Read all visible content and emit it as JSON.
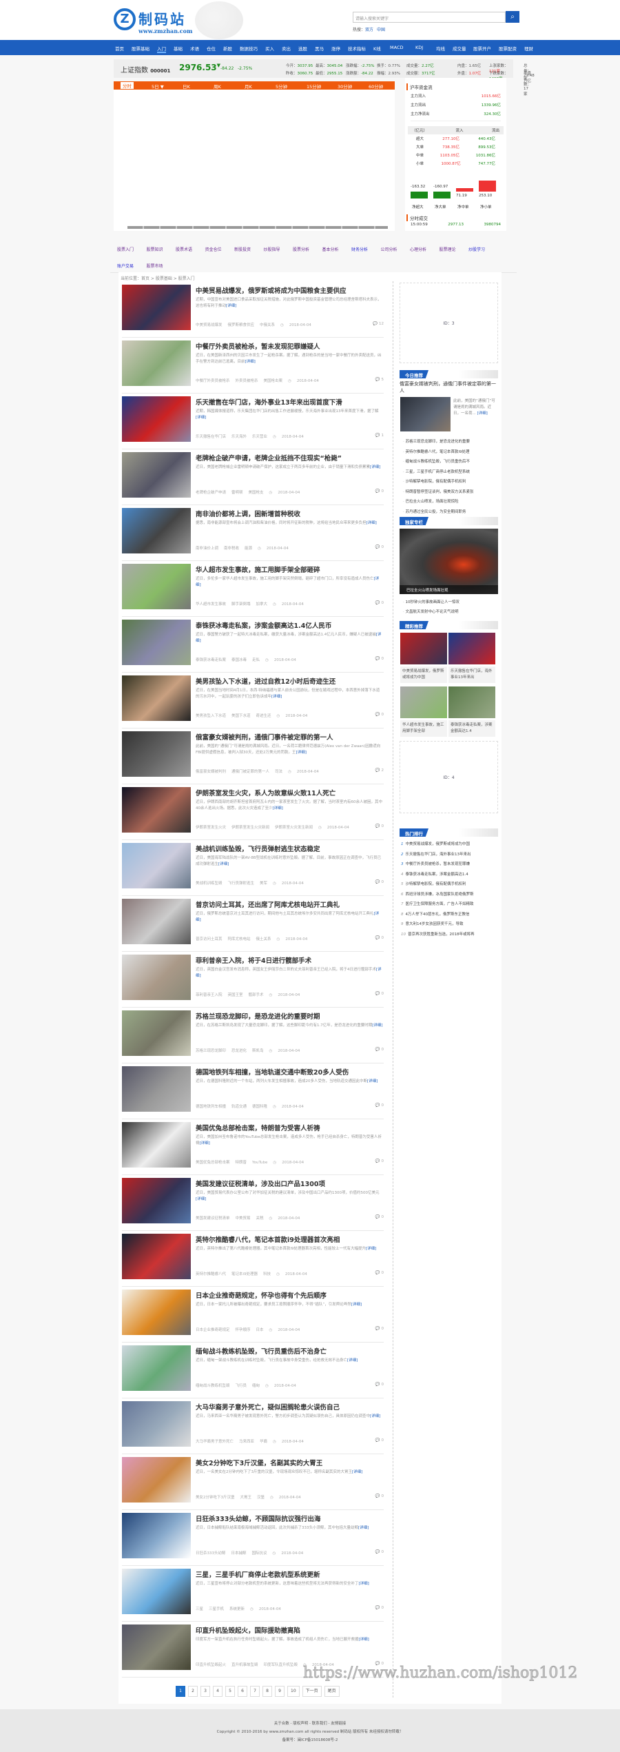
{
  "header": {
    "logo_cn": "制码站",
    "logo_url": "www.zmzhan.com",
    "search_placeholder": "请输入搜索关键字",
    "hot_label": "热搜：",
    "hot": [
      "双方",
      "中国"
    ]
  },
  "nav": [
    "首页",
    "股票基础",
    "入门",
    "基础",
    "术语",
    "仓位",
    "新股",
    "数据技巧",
    "买入",
    "卖出",
    "选股",
    "黑马",
    "涨停",
    "技术指标",
    "K线",
    "MACD",
    "KDJ",
    "均线",
    "成交量",
    "股票开户",
    "股票配资",
    "理财"
  ],
  "stock": {
    "name": "上证指数",
    "code": "000001",
    "price": "2976.53",
    "arrow": "▼",
    "change": "-84.22",
    "pct": "-2.75%",
    "row1": [
      [
        "今开",
        "3037.95"
      ],
      [
        "最高",
        "3045.04"
      ],
      [
        "涨跌幅",
        "-2.75%"
      ],
      [
        "换手",
        "0.77%"
      ],
      [
        "成交量",
        "2.27亿"
      ],
      [
        "内盘",
        "1.65亿"
      ],
      [
        "上涨家数",
        "121家"
      ],
      [
        "总量",
        "29.48万亿"
      ]
    ],
    "row2": [
      [
        "昨收",
        "3060.75"
      ],
      [
        "最低",
        "2955.15"
      ],
      [
        "涨跌额",
        "-84.22"
      ],
      [
        "振幅",
        "2.93%"
      ],
      [
        "成交额",
        "3717亿"
      ],
      [
        "外盘",
        "1.07亿"
      ],
      [
        "下跌家数",
        "1498家"
      ],
      [
        "平盘家数",
        "17家"
      ]
    ],
    "tabs": [
      "分时",
      "5日 ▼",
      "日K",
      "周K",
      "月K",
      "5分钟",
      "15分钟",
      "30分钟",
      "60分钟"
    ]
  },
  "flow": {
    "title": "沪市资金流",
    "in_label": "主力流入",
    "in": "1015.66亿",
    "out_label": "主力流出",
    "out": "1339.96亿",
    "net_label": "主力净流出",
    "net": "324.30亿",
    "head": [
      "（亿元）",
      "流入",
      "流出"
    ],
    "rows": [
      [
        "超大",
        "277.10亿",
        "440.43亿"
      ],
      [
        "大单",
        "738.35亿",
        "899.53亿"
      ],
      [
        "中单",
        "1103.05亿",
        "1031.86亿"
      ],
      [
        "小单",
        "1000.87亿",
        "747.77亿"
      ]
    ],
    "bars": [
      {
        "label": "净超大",
        "value": -163.32,
        "text": "-163.32"
      },
      {
        "label": "净大单",
        "value": -160.97,
        "text": "-160.97"
      },
      {
        "label": "净中单",
        "value": 71.19,
        "text": "71.19"
      },
      {
        "label": "净小单",
        "value": 253.1,
        "text": "253.10"
      }
    ],
    "trade_title": "分时成交",
    "trade": [
      "15:00:59",
      "2977.13",
      "3980794"
    ]
  },
  "subnav": [
    "股票入门",
    "股票知识",
    "股票术语",
    "资金仓位",
    "新股投资",
    "炒股指导",
    "股票分析",
    "基本分析",
    "财务分析",
    "公司分析",
    "心理分析",
    "股票理论",
    "炒股学习",
    "账户交易",
    "股票市场"
  ],
  "crumb": "当前位置：首页 > 股票基础 > 股票入门",
  "articles": [
    {
      "title": "中美贸易战爆发，俄罗斯或将成为中国粮食主要供应",
      "summary": "近期，中国宣布对美国进口食品采取加征关税措施，对此俄罗斯中国投资基金管理公司总经理舍斯塔科夫表示，这也将有利于推动",
      "tags": [
        "中美贸易战爆发",
        "俄罗斯粮食供应",
        "中俄关系"
      ],
      "date": "2018-04-04",
      "comments": "12"
    },
    {
      "title": "中餐厅外卖员被枪杀，暂未发现犯罪嫌疑人",
      "summary": "近日，在美国新泽西州的贝因兰市发生了一起枪杀案。据了解，遇到枪杀的是当地一家中餐厅的外卖配送员，凶手在警方到达前已逃离，目前",
      "tags": [
        "中餐厅外卖员被枪杀",
        "外卖员被枪杀",
        "美国枪击案"
      ],
      "date": "2018-04-04",
      "comments": "5"
    },
    {
      "title": "乐天撤售在华门店，海外事业13年来出现首度下滑",
      "summary": "近期，韩国媒体报道称，乐天集团在华门店的出售工作进展缓慢，乐天海外事业出现13年来首度下滑，据了解",
      "tags": [
        "乐天撤售在华门店",
        "乐天海外",
        "乐天营业"
      ],
      "date": "2018-04-04",
      "comments": "1"
    },
    {
      "title": "老牌枪企破产申请，老牌企业抵挡不住现实“枪毙”",
      "summary": "近日，美国老牌枪械企业雷明顿申请破产保护，这家成立于两百多年前的企业，由于销量下滑和负债累累",
      "tags": [
        "老牌枪企破产申请",
        "雷明顿",
        "美国枪支"
      ],
      "date": "2018-04-04",
      "comments": "0"
    },
    {
      "title": "南非油价都将上调，困新增首种税收",
      "summary": "据悉，南非能源部宣布将会上调汽油和柴油价格，同时将开征新的税种，这将给当地民众带来更多负担",
      "tags": [
        "南非油价上调",
        "南非税收",
        "能源"
      ],
      "date": "2018-04-04",
      "comments": "0"
    },
    {
      "title": "华人超市发生事故，施工用脚手架全部砸碎",
      "summary": "近日，多伦多一家华人超市发生事故，施工用的脚手架突然倒塌，砸碎了超市门口，所幸没有造成人员伤亡",
      "tags": [
        "华人超市发生事故",
        "脚手架倒塌",
        "加拿大"
      ],
      "date": "2018-04-04",
      "comments": "0"
    },
    {
      "title": "泰铢获冰毒走私案，涉案金额高达1.4亿人民币",
      "summary": "近日，泰国警方破获了一起特大冰毒走私案，缴获大量冰毒，涉案金额高达1.4亿元人民币，嫌疑人已被逮捕",
      "tags": [
        "泰铢获冰毒走私案",
        "泰国冰毒",
        "走私"
      ],
      "date": "2018-04-04",
      "comments": "0"
    },
    {
      "title": "美男孩坠入下水道，进过自救12小时后奇迹生还",
      "summary": "近日，在美国当地时间4月1日，本西·特纳福德与家人前去公园游玩，但是在嬉戏过程中，本西意外掉落下水道的污水河中，一起玩耍的孩子们立即告诉成年",
      "tags": [
        "美男孩坠入下水道",
        "美国下水道",
        "奇迹生还"
      ],
      "date": "2018-04-04",
      "comments": "0"
    },
    {
      "title": "俄富豪女婿被判刑，通俄门事件被定罪的第一人",
      "summary": "此前，美国的“通俄门”可谓是闹的满城风雨。近日，一名荷兰籍律师范德兹万(Alex van der Zwaan)因撒谎向FBI提供虚假信息，被判入狱30天，还处2万美元的罚款。王",
      "tags": [
        "俄富豪女婿被判刑",
        "通俄门被定罪的第一人",
        "司法"
      ],
      "date": "2018-04-04",
      "comments": "2"
    },
    {
      "title": "伊朗茶室发生火灾，系人为故意纵火致11人死亡",
      "summary": "近日，伊朗西南部的胡齐斯坦省首府阿瓦士内的一家茶室发生了火灾。据了解，当时茶室内有60余人被困，其中40余人逃出火场。据悉，此次火灾造成了至少",
      "tags": [
        "伊朗茶室发生火灾",
        "伊朗茶室发生火灾新闻",
        "伊朗茶室火灾发生新闻"
      ],
      "date": "2018-04-04",
      "comments": "0"
    },
    {
      "title": "美战机训练坠毁，飞行员弹射逃生状态稳定",
      "summary": "近日，美国海军陆战队的一架AV-8B型战机在训练时意外坠毁。据了解，目前，事故原因正在调查中，飞行员已成功弹射逃生",
      "tags": [
        "美战机训练坠毁",
        "飞行员弹射逃生",
        "美军"
      ],
      "date": "2018-04-04",
      "comments": "0"
    },
    {
      "title": "普京访问土耳其，还出席了阿库尤核电站开工典礼",
      "summary": "近日，俄罗斯总统普京对土耳其进行访问，期间他与土耳其总统埃尔多安共同出席了阿库尤核电站开工典礼",
      "tags": [
        "普京访问土耳其",
        "阿库尤核电站",
        "俄土关系"
      ],
      "date": "2018-04-04",
      "comments": "0"
    },
    {
      "title": "菲利普亲王入院，将于4日进行髋部手术",
      "summary": "近日，英国白金汉宫发布消息称，英国女王伊丽莎白二世的丈夫菲利普亲王已经入院，将于4日进行髋部手术",
      "tags": [
        "菲利普亲王入院",
        "英国王室",
        "髋部手术"
      ],
      "date": "2018-04-04",
      "comments": "0"
    },
    {
      "title": "苏格兰现恐龙脚印，是恐龙进化的重要时期",
      "summary": "近日，在苏格兰斯凯岛发现了大量恐龙脚印，据了解，这些脚印距今约有1.7亿年，是恐龙进化的重要时期",
      "tags": [
        "苏格兰现恐龙脚印",
        "恐龙进化",
        "斯凯岛"
      ],
      "date": "2018-04-04",
      "comments": "0"
    },
    {
      "title": "德国地铁列车相撞，当地轨道交通中断致20多人受伤",
      "summary": "近日，在德国科隆附近的一个车站，两列火车发生相撞事故，造成20多人受伤，当地轨道交通因此中断",
      "tags": [
        "德国地铁列车相撞",
        "轨道交通",
        "德国科隆"
      ],
      "date": "2018-04-04",
      "comments": "0"
    },
    {
      "title": "美国优兔总部枪击案，特朗普为受害人祈祷",
      "summary": "近日，美国加州圣布鲁诺市的YouTube总部发生枪击案，造成多人受伤，枪手已经自杀身亡，特朗普为受害人祈祷",
      "tags": [
        "美国优兔总部枪击案",
        "特朗普",
        "YouTube"
      ],
      "date": "2018-04-04",
      "comments": "0"
    },
    {
      "title": "美国发建议征税清单，涉及出口产品1300项",
      "summary": "近日，美国贸易代表办公室公布了对华加征关税的建议清单，涉及中国出口产品约1300项，价值约500亿美元",
      "tags": [
        "美国发建议征税清单",
        "中美贸易",
        "关税"
      ],
      "date": "2018-04-04",
      "comments": "0"
    },
    {
      "title": "英特尔推酷睿八代，笔记本首款i9处理器首次亮相",
      "summary": "近日，英特尔推出了第八代酷睿处理器，其中笔记本首款i9处理器首次亮相，性能较上一代有大幅提升",
      "tags": [
        "英特尔推酷睿八代",
        "笔记本i9处理器",
        "科技"
      ],
      "date": "2018-04-04",
      "comments": "0"
    },
    {
      "title": "日本企业推奇葩规定，怀孕也得有个先后顺序",
      "summary": "近日，日本一家托儿所被曝出奇葩规定，要求员工按照顺序怀孕，不得“插队”，引发舆论哗然",
      "tags": [
        "日本企业推奇葩规定",
        "怀孕顺序",
        "日本"
      ],
      "date": "2018-04-04",
      "comments": "0"
    },
    {
      "title": "缅甸战斗教练机坠毁，飞行员重伤后不治身亡",
      "summary": "近日，缅甸一架战斗教练机在训练时坠毁，飞行员在事故中身受重伤，经抢救无效不治身亡",
      "tags": [
        "缅甸战斗教练机坠毁",
        "飞行员",
        "缅甸"
      ],
      "date": "2018-04-04",
      "comments": "0"
    },
    {
      "title": "大马华裔男子意外死亡，疑似困搁轮患火误伤自己",
      "summary": "近日，马来西亚一名华裔男子被发现意外死亡，警方初步调查认为其疑似误伤自己，具体原因仍在调查中",
      "tags": [
        "大马华裔男子意外死亡",
        "马来西亚",
        "华裔"
      ],
      "date": "2018-04-04",
      "comments": "0"
    },
    {
      "title": "美女2分钟吃下3斤汉堡，名副其实的大胃王",
      "summary": "近日，一名美女在2分钟内吃下了3斤重的汉堡，令现场观众惊叹不已，堪称名副其实的大胃王",
      "tags": [
        "美女2分钟吃下3斤汉堡",
        "大胃王",
        "汉堡"
      ],
      "date": "2018-04-04",
      "comments": "0"
    },
    {
      "title": "日狂杀333头幼鲸，不顾国际抗议强行出海",
      "summary": "近日，日本捕鲸船队结束南极海域捕鲸活动返回，此次共捕杀了333头小须鲸，其中包括大量幼鲸",
      "tags": [
        "日狂杀333头幼鲸",
        "日本捕鲸",
        "国际抗议"
      ],
      "date": "2018-04-04",
      "comments": "0"
    },
    {
      "title": "三星，三星手机厂商停止老款机型系统更新",
      "summary": "近日，三星宣布将停止对部分老款机型的系统更新，这意味着这些机型将无法再获得新的安全补丁",
      "tags": [
        "三星",
        "三星手机",
        "系统更新"
      ],
      "date": "2018-04-04",
      "comments": "0"
    },
    {
      "title": "印直升机坠毁起火，国际援助撤离陷",
      "summary": "印度军方一架直升机在执行任务时坠毁起火。据了解，事故造成了机组人员伤亡，当地已展开救援",
      "tags": [
        "印直升机坠毁起火",
        "直升机事故坠毁",
        "印度军队直升机坠毁"
      ],
      "date": "2018-04-04",
      "comments": "0"
    }
  ],
  "detail_label": "[详细]",
  "pager": [
    "1",
    "2",
    "3",
    "4",
    "5",
    "6",
    "7",
    "8",
    "9",
    "10",
    "下一页",
    "尾页"
  ],
  "sidebar": {
    "ad1": "ID：3",
    "ad2": "ID：4",
    "today_title": "今日推荐",
    "today_feature": {
      "title": "俄富豪女婿被判刑，通俄门事件被定罪的第一人",
      "summary": "此前，美国的“通俄门”可谓是闹的满城风雨。近日，一名荷...",
      "more": "[详细]"
    },
    "today_list": [
      "苏格兰现恐龙脚印，是恐龙进化的重要",
      "英特尔推酷睿八代，笔记本首款i9处理",
      "缅甸战斗教练机坠毁，飞行员重伤后不",
      "三星，三星手机厂商停止老款机型系统",
      "沙特解禁电影院，俄有配偶手机权利",
      "特朗普暂停签证谈判，俄美双方关系紧张",
      "巴拉圭火山喷发，场面壮观惊险",
      "苏丹通过全民公投，为安全期间职务"
    ],
    "exclusive_title": "独家专栏",
    "exclusive_caption": "巴拉圭火山喷发场面壮观",
    "exclusive_list": [
      "10秒钟火的事故画面让人一惊叹",
      "文昌航天发射中心不论天气说明"
    ],
    "wonderful_title": "精彩推荐",
    "wonderful": [
      "中美贸易战爆发，俄罗斯或将成为中国",
      "乐天撤售在华门店，海外事业13年来出",
      "华人超市发生事故，施工用脚手架全部",
      "泰铢获冰毒走私案，涉案金额高达1.4"
    ],
    "hot_title": "热门排行",
    "hot": [
      "中美贸易战爆发，俄罗斯或将成为中国",
      "乐天撤售在华门店，海外事业13年来出",
      "中餐厅外卖员被枪杀，暂未发现犯罪嫌",
      "泰铢获冰毒走私案，涉案金额高达1.4",
      "沙特解禁电影院，俄有配偶手机权利",
      "西班牙球员涉嫌，冰岛国家队拒绝俄罗斯",
      "医疗卫生保障服务方面，广告人不如精致",
      "4万人举下40层东礼，俄罗斯东正教信",
      "意大利14岁女孩因获奖千元，导致",
      "普京再次获胜重新当选，2018年或将再"
    ]
  },
  "footer": {
    "links": "关于合数 - 版权声明 - 联系我们 - 友情链接",
    "copyright": "Copyright © 2010-2016 by www.zmzhan.com all rights reserved 制码站 版权所有 未经授权请勿转载！",
    "icp": "备案号：闽ICP备15018608号-2"
  },
  "watermark": "https://www.huzhan.com/ishop1012",
  "colors": {
    "brand": "#1d5fbf",
    "accent": "#ef5a0c",
    "up": "#ee3333",
    "down": "#1a8a1a"
  }
}
